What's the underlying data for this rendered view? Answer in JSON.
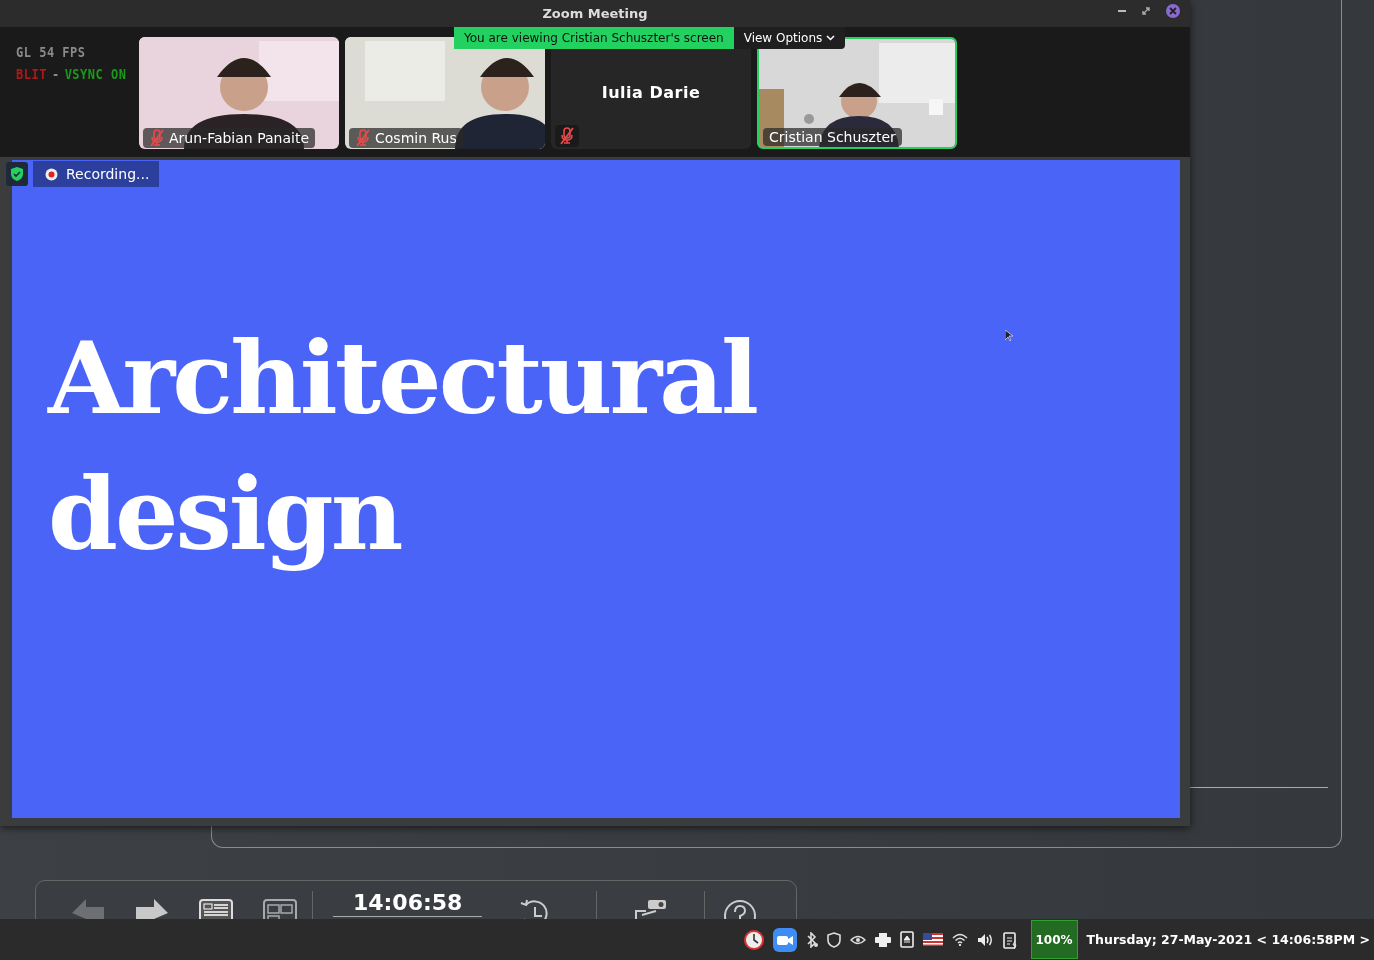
{
  "window": {
    "title": "Zoom Meeting"
  },
  "stats_overlay": [
    {
      "parts": [
        {
          "text": "GL 54 FPS",
          "color": "#8a8a8a"
        }
      ]
    },
    {
      "parts": [
        {
          "text": "BLIT",
          "color": "#b01818"
        },
        {
          "text": "-",
          "color": "#8a8a8a"
        },
        {
          "text": "VSYNC ON",
          "color": "#1a9a1a"
        }
      ]
    }
  ],
  "share_banner": {
    "text": "You are viewing Cristian Schuszter's screen"
  },
  "view_options": {
    "label": "View Options"
  },
  "participants": [
    {
      "name": "Arun-Fabian Panaite",
      "kind": "video",
      "muted": true,
      "active": false
    },
    {
      "name": "Cosmin Rus",
      "kind": "video",
      "muted": true,
      "active": false
    },
    {
      "name": "Iulia Darie",
      "kind": "name_only",
      "muted": true,
      "active": false
    },
    {
      "name": "Cristian Schuszter",
      "kind": "video",
      "muted": false,
      "active": true
    }
  ],
  "recording": {
    "label": "Recording..."
  },
  "slide": {
    "title": "Architectural design"
  },
  "presenter_toolbar": {
    "time": "14:06:58"
  },
  "taskbar": {
    "battery": "100%",
    "clock": "Thursday; 27-May-2021 < 14:06:58PM >"
  }
}
